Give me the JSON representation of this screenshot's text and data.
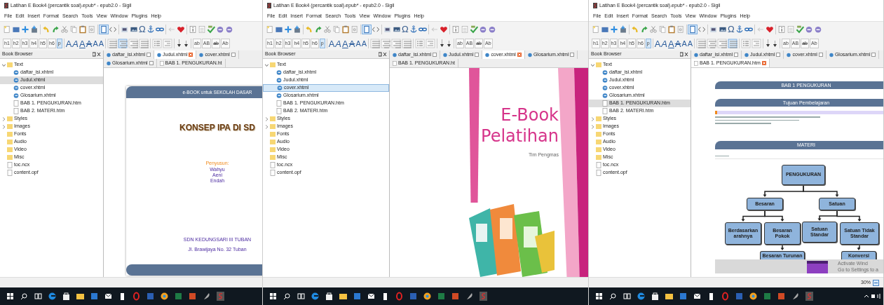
{
  "windows": [
    {
      "title": "Latihan E Book4 (percantik soal).epub* - epub2.0 - Sigil",
      "menu": [
        "File",
        "Edit",
        "Insert",
        "Format",
        "Search",
        "Tools",
        "View",
        "Window",
        "Plugins",
        "Help"
      ],
      "special_char": "Ω",
      "headings": [
        {
          "label": "h1",
          "selected": false
        },
        {
          "label": "h2",
          "selected": false
        },
        {
          "label": "h3",
          "selected": false
        },
        {
          "label": "h4",
          "selected": false
        },
        {
          "label": "h5",
          "selected": false
        },
        {
          "label": "h6",
          "selected": false
        },
        {
          "label": "p",
          "selected": true
        }
      ],
      "font_styles": [
        "A",
        "A",
        "A",
        "A",
        "A",
        "A"
      ],
      "alignment": [
        {
          "selected": false
        },
        {
          "selected": true
        },
        {
          "selected": false
        },
        {
          "selected": false
        }
      ],
      "case_buttons": [
        "ab",
        "AB",
        "ab",
        "Ab"
      ],
      "browser_title": "Book Browser",
      "tree_focused": false,
      "tree": [
        {
          "label": "Text",
          "kind": "folder",
          "expanded": true,
          "children": [
            {
              "label": "daftar_isi.xhtml",
              "kind": "xhtml",
              "selected": false
            },
            {
              "label": "Judul.xhtml",
              "kind": "xhtml",
              "selected": true
            },
            {
              "label": "cover.xhtml",
              "kind": "xhtml",
              "selected": false
            },
            {
              "label": "Glosarium.xhtml",
              "kind": "xhtml",
              "selected": false
            },
            {
              "label": "BAB 1. PENGUKURAN.htm",
              "kind": "page",
              "selected": false
            },
            {
              "label": "BAB 2. MATERI.htm",
              "kind": "page",
              "selected": false
            }
          ]
        },
        {
          "label": "Styles",
          "kind": "folder",
          "expanded": false
        },
        {
          "label": "Images",
          "kind": "folder",
          "expanded": false
        },
        {
          "label": "Fonts",
          "kind": "folder"
        },
        {
          "label": "Audio",
          "kind": "folder"
        },
        {
          "label": "Video",
          "kind": "folder"
        },
        {
          "label": "Misc",
          "kind": "folder"
        },
        {
          "label": "toc.ncx",
          "kind": "page"
        },
        {
          "label": "content.opf",
          "kind": "page"
        }
      ],
      "tabs": [
        {
          "label": "daftar_isi.xhtml",
          "selected": false
        },
        {
          "label": "Judul.xhtml",
          "selected": true
        },
        {
          "label": "cover.xhtml",
          "selected": false
        },
        {
          "label": "Glosarium.xhtml",
          "selected": false
        },
        {
          "label": "BAB 1. PENGUKURAN.ht",
          "selected": false
        }
      ],
      "content": {
        "kind": "title_page",
        "header": "e-BOOK untuk SEKOLAH DASAR",
        "title": "KONSEP IPA DI SD",
        "author_label": "Penyusun:",
        "authors": [
          "Wahyu",
          "Aeni",
          "Endah"
        ],
        "school": "SDN KEDUNGSARI III TUBAN",
        "address": "Jl. Brawijaya No. 32 Tuban"
      }
    },
    {
      "title": "Latihan E Book4 (percantik soal).epub* - epub2.0 - Sigil",
      "menu": [
        "File",
        "Edit",
        "Insert",
        "Format",
        "Search",
        "Tools",
        "View",
        "Window",
        "Plugins",
        "Help"
      ],
      "special_char": "Ω",
      "headings": [
        {
          "label": "h1",
          "selected": false
        },
        {
          "label": "h2",
          "selected": false
        },
        {
          "label": "h3",
          "selected": false
        },
        {
          "label": "h4",
          "selected": false
        },
        {
          "label": "h5",
          "selected": false
        },
        {
          "label": "h6",
          "selected": false
        },
        {
          "label": "p",
          "selected": true
        }
      ],
      "font_styles": [
        "A",
        "A",
        "A",
        "A",
        "A",
        "A"
      ],
      "alignment": [
        {
          "selected": false
        },
        {
          "selected": false
        },
        {
          "selected": false
        },
        {
          "selected": false
        }
      ],
      "case_buttons": [
        "ab",
        "AB",
        "ab",
        "Ab"
      ],
      "browser_title": "Book Browser",
      "tree_focused": true,
      "tree": [
        {
          "label": "Text",
          "kind": "folder",
          "expanded": true,
          "children": [
            {
              "label": "daftar_isi.xhtml",
              "kind": "xhtml",
              "selected": false
            },
            {
              "label": "Judul.xhtml",
              "kind": "xhtml",
              "selected": false
            },
            {
              "label": "cover.xhtml",
              "kind": "xhtml",
              "selected": true
            },
            {
              "label": "Glosarium.xhtml",
              "kind": "xhtml",
              "selected": false
            },
            {
              "label": "BAB 1. PENGUKURAN.htm",
              "kind": "page",
              "selected": false
            },
            {
              "label": "BAB 2. MATERI.htm",
              "kind": "page",
              "selected": false
            }
          ]
        },
        {
          "label": "Styles",
          "kind": "folder",
          "expanded": false
        },
        {
          "label": "Images",
          "kind": "folder",
          "expanded": false
        },
        {
          "label": "Fonts",
          "kind": "folder"
        },
        {
          "label": "Audio",
          "kind": "folder"
        },
        {
          "label": "Video",
          "kind": "folder"
        },
        {
          "label": "Misc",
          "kind": "folder"
        },
        {
          "label": "toc.ncx",
          "kind": "page"
        },
        {
          "label": "content.opf",
          "kind": "page"
        }
      ],
      "tabs": [
        {
          "label": "daftar_isi.xhtml",
          "selected": false
        },
        {
          "label": "Judul.xhtml",
          "selected": false
        },
        {
          "label": "cover.xhtml",
          "selected": true
        },
        {
          "label": "Glosarium.xhtml",
          "selected": false
        },
        {
          "label": "BAB 1. PENGUKURAN.ht",
          "selected": false
        }
      ],
      "content": {
        "kind": "cover",
        "title_lines": [
          "E-Book",
          "Pelatihan"
        ],
        "subtitle": "Tim Pengmas"
      }
    },
    {
      "title": "Latihan E Book4 (percantik soal).epub* - epub2.0 - Sigil",
      "menu": [
        "File",
        "Edit",
        "Insert",
        "Format",
        "Search",
        "Tools",
        "View",
        "Window",
        "Plugins",
        "Help"
      ],
      "special_char": "Ω",
      "headings": [
        {
          "label": "h1",
          "selected": false
        },
        {
          "label": "h2",
          "selected": false
        },
        {
          "label": "h3",
          "selected": false
        },
        {
          "label": "h4",
          "selected": false
        },
        {
          "label": "h5",
          "selected": false
        },
        {
          "label": "h6",
          "selected": false
        },
        {
          "label": "p",
          "selected": true
        }
      ],
      "font_styles": [
        "A",
        "A",
        "A",
        "A",
        "A",
        "A"
      ],
      "alignment": [
        {
          "selected": false
        },
        {
          "selected": false
        },
        {
          "selected": false
        },
        {
          "selected": true
        }
      ],
      "case_buttons": [
        "ab",
        "AB",
        "ab",
        "Ab"
      ],
      "browser_title": "Book Browser",
      "tree_focused": false,
      "tree": [
        {
          "label": "Text",
          "kind": "folder",
          "expanded": true,
          "children": [
            {
              "label": "daftar_isi.xhtml",
              "kind": "xhtml",
              "selected": false
            },
            {
              "label": "Judul.xhtml",
              "kind": "xhtml",
              "selected": false
            },
            {
              "label": "cover.xhtml",
              "kind": "xhtml",
              "selected": false
            },
            {
              "label": "Glosarium.xhtml",
              "kind": "xhtml",
              "selected": false
            },
            {
              "label": "BAB 1. PENGUKURAN.htm",
              "kind": "page",
              "selected": true
            },
            {
              "label": "BAB 2. MATERI.htm",
              "kind": "page",
              "selected": false
            }
          ]
        },
        {
          "label": "Styles",
          "kind": "folder",
          "expanded": false
        },
        {
          "label": "Images",
          "kind": "folder",
          "expanded": false
        },
        {
          "label": "Fonts",
          "kind": "folder"
        },
        {
          "label": "Audio",
          "kind": "folder"
        },
        {
          "label": "Video",
          "kind": "folder"
        },
        {
          "label": "Misc",
          "kind": "folder"
        },
        {
          "label": "toc.ncx",
          "kind": "page"
        },
        {
          "label": "content.opf",
          "kind": "page"
        }
      ],
      "tabs": [
        {
          "label": "daftar_isi.xhtml",
          "selected": false
        },
        {
          "label": "Judul.xhtml",
          "selected": false
        },
        {
          "label": "cover.xhtml",
          "selected": false
        },
        {
          "label": "Glosarium.xhtml",
          "selected": false
        },
        {
          "label": "BAB 1. PENGUKURAN.htm",
          "selected": true
        }
      ],
      "content": {
        "kind": "chapter",
        "bars": [
          "BAB 1 PENGUKURAN",
          "Tujuan Pembelajaran"
        ],
        "section_bar": "MATERI",
        "diagram": {
          "label": "PENGUKURAN",
          "children": [
            {
              "label": "Besaran",
              "children": [
                {
                  "label": "Berdasarkan arahnya"
                },
                {
                  "label": "Besaran Pokok",
                  "children": [
                    {
                      "label": "Besaran Turunan"
                    }
                  ]
                }
              ]
            },
            {
              "label": "Satuan",
              "children": [
                {
                  "label": "Satuan Standar"
                },
                {
                  "label": "Satuan Tidak Standar",
                  "children": [
                    {
                      "label": "Konversi"
                    }
                  ]
                }
              ]
            }
          ]
        },
        "overlay_lines": [
          "Activate Wind",
          "Go to Settings to a"
        ]
      },
      "status": {
        "zoom": "30%"
      }
    }
  ]
}
